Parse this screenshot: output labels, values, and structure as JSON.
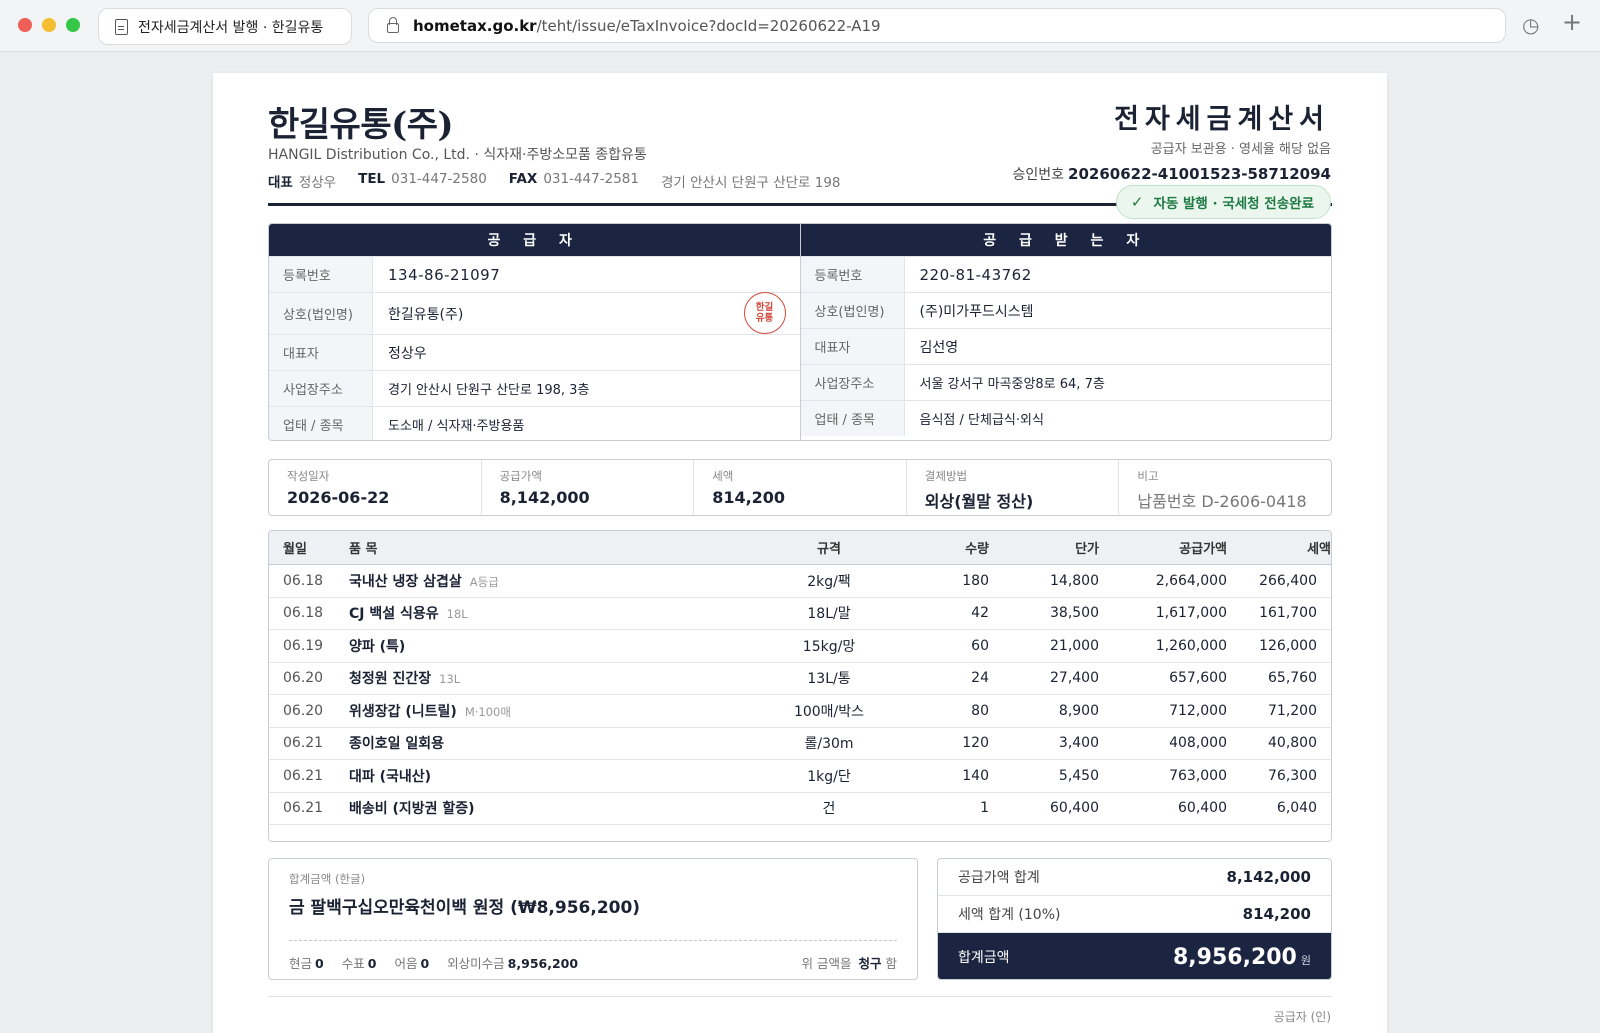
{
  "browser": {
    "tab_title": "전자세금계산서 발행 · 한길유통",
    "url_host": "hometax.go.kr",
    "url_path": "/teht/issue/eTaxInvoice?docId=20260622-A19"
  },
  "header": {
    "company": "한길유통(주)",
    "subtitle": "HANGIL Distribution Co., Ltd.  ·  식자재·주방소모품 종합유통",
    "ceo_label": "대표",
    "ceo": "정상우",
    "tel_label": "TEL",
    "tel": "031-447-2580",
    "fax_label": "FAX",
    "fax": "031-447-2581",
    "address": "경기 안산시 단원구 산단로 198",
    "doc_title": "전자세금계산서",
    "doc_sub": "공급자 보관용 · 영세율 해당 없음",
    "approval_label": "승인번호",
    "approval_no": "20260622-41001523-58712094",
    "status_badge": "자동 발행 · 국세청 전송완료"
  },
  "supplier": {
    "title": "공 급 자",
    "reg_label": "등록번호",
    "reg": "134-86-21097",
    "name_label": "상호(법인명)",
    "name": "한길유통(주)",
    "stamp": "한길\n유통",
    "rep_label": "대표자",
    "rep": "정상우",
    "addr_label": "사업장주소",
    "addr": "경기 안산시 단원구 산단로 198, 3층",
    "type_label": "업태 / 종목",
    "type": "도소매 / 식자재·주방용품"
  },
  "buyer": {
    "title": "공 급 받 는 자",
    "reg_label": "등록번호",
    "reg": "220-81-43762",
    "name_label": "상호(법인명)",
    "name": "(주)미가푸드시스템",
    "rep_label": "대표자",
    "rep": "김선영",
    "addr_label": "사업장주소",
    "addr": "서울 강서구 마곡중앙8로 64, 7층",
    "type_label": "업태 / 종목",
    "type": "음식점 / 단체급식·외식"
  },
  "meta": {
    "date_label": "작성일자",
    "date": "2026-06-22",
    "supply_label": "공급가액",
    "supply": "8,142,000",
    "tax_label": "세액",
    "tax": "814,200",
    "payment_label": "결제방법",
    "payment": "외상(월말 정산)",
    "note_label": "비고",
    "note": "납품번호 D-2606-0418"
  },
  "items": {
    "headers": {
      "date": "월일",
      "name": "품 목",
      "spec": "규격",
      "qty": "수량",
      "price": "단가",
      "amount": "공급가액",
      "tax": "세액"
    },
    "rows": [
      {
        "date": "06.18",
        "name": "국내산 냉장 삼겹살",
        "note": "A등급",
        "spec": "2kg/팩",
        "qty": "180",
        "price": "14,800",
        "amount": "2,664,000",
        "tax": "266,400"
      },
      {
        "date": "06.18",
        "name": "CJ 백설 식용유",
        "note": "18L",
        "spec": "18L/말",
        "qty": "42",
        "price": "38,500",
        "amount": "1,617,000",
        "tax": "161,700"
      },
      {
        "date": "06.19",
        "name": "양파 (특)",
        "note": "",
        "spec": "15kg/망",
        "qty": "60",
        "price": "21,000",
        "amount": "1,260,000",
        "tax": "126,000"
      },
      {
        "date": "06.20",
        "name": "청정원 진간장",
        "note": "13L",
        "spec": "13L/통",
        "qty": "24",
        "price": "27,400",
        "amount": "657,600",
        "tax": "65,760"
      },
      {
        "date": "06.20",
        "name": "위생장갑 (니트릴)",
        "note": "M·100매",
        "spec": "100매/박스",
        "qty": "80",
        "price": "8,900",
        "amount": "712,000",
        "tax": "71,200"
      },
      {
        "date": "06.21",
        "name": "종이호일 일회용",
        "note": "",
        "spec": "롤/30m",
        "qty": "120",
        "price": "3,400",
        "amount": "408,000",
        "tax": "40,800"
      },
      {
        "date": "06.21",
        "name": "대파 (국내산)",
        "note": "",
        "spec": "1kg/단",
        "qty": "140",
        "price": "5,450",
        "amount": "763,000",
        "tax": "76,300"
      },
      {
        "date": "06.21",
        "name": "배송비 (지방권 할증)",
        "note": "",
        "spec": "건",
        "qty": "1",
        "price": "60,400",
        "amount": "60,400",
        "tax": "6,040"
      }
    ]
  },
  "summary": {
    "words_label": "합계금액 (한글)",
    "words": "금 팔백구십오만육천이백 원정 (₩8,956,200)",
    "cash_label": "현금",
    "cash": "0",
    "check_label": "수표",
    "check": "0",
    "bill_label": "어음",
    "bill": "0",
    "credit_label": "외상미수금",
    "credit": "8,956,200",
    "claim_prefix": "위 금액을",
    "claim_word": "청구",
    "claim_suffix": "함",
    "supply_total_label": "공급가액 합계",
    "supply_total": "8,142,000",
    "tax_total_label": "세액 합계 (10%)",
    "tax_total": "814,200",
    "grand_label": "합계금액",
    "grand": "8,956,200",
    "grand_unit": "원"
  },
  "footer": {
    "signer": "공급자 (인)"
  }
}
